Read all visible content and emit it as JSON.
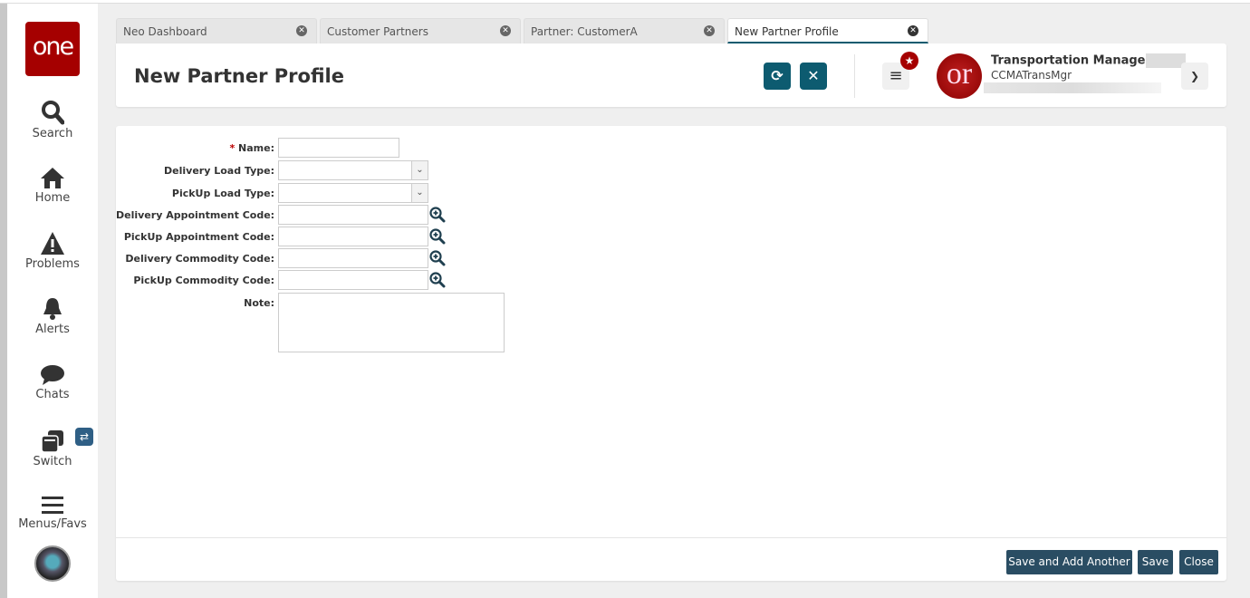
{
  "sidebar": {
    "logo": "one",
    "items": [
      {
        "label": "Search",
        "icon": "search-icon"
      },
      {
        "label": "Home",
        "icon": "home-icon"
      },
      {
        "label": "Problems",
        "icon": "warning-icon"
      },
      {
        "label": "Alerts",
        "icon": "bell-icon"
      },
      {
        "label": "Chats",
        "icon": "chat-icon"
      },
      {
        "label": "Switch",
        "icon": "switch-icon"
      },
      {
        "label": "Menus/Favs",
        "icon": "hamburger-icon"
      }
    ]
  },
  "tabs": [
    {
      "label": "Neo Dashboard"
    },
    {
      "label": "Customer Partners"
    },
    {
      "label": "Partner: CustomerA"
    },
    {
      "label": "New Partner Profile",
      "active": true
    }
  ],
  "header": {
    "title": "New Partner Profile",
    "user_name": "Transportation Manage",
    "user_role": "CCMATransMgr",
    "avatar_text": "or"
  },
  "form": {
    "fields": [
      {
        "label": "Name:",
        "required": true,
        "type": "text",
        "value": ""
      },
      {
        "label": "Delivery Load Type:",
        "type": "select",
        "value": ""
      },
      {
        "label": "PickUp Load Type:",
        "type": "select",
        "value": ""
      },
      {
        "label": "Delivery Appointment Code:",
        "type": "lookup",
        "value": ""
      },
      {
        "label": "PickUp Appointment Code:",
        "type": "lookup",
        "value": ""
      },
      {
        "label": "Delivery Commodity Code:",
        "type": "lookup",
        "value": ""
      },
      {
        "label": "PickUp Commodity Code:",
        "type": "lookup",
        "value": ""
      },
      {
        "label": "Note:",
        "type": "textarea",
        "value": ""
      }
    ]
  },
  "buttons": {
    "save_add": "Save and Add Another",
    "save": "Save",
    "close": "Close"
  },
  "colors": {
    "brand": "#a50000",
    "accent": "#0d5b70",
    "button": "#2a4d63"
  }
}
